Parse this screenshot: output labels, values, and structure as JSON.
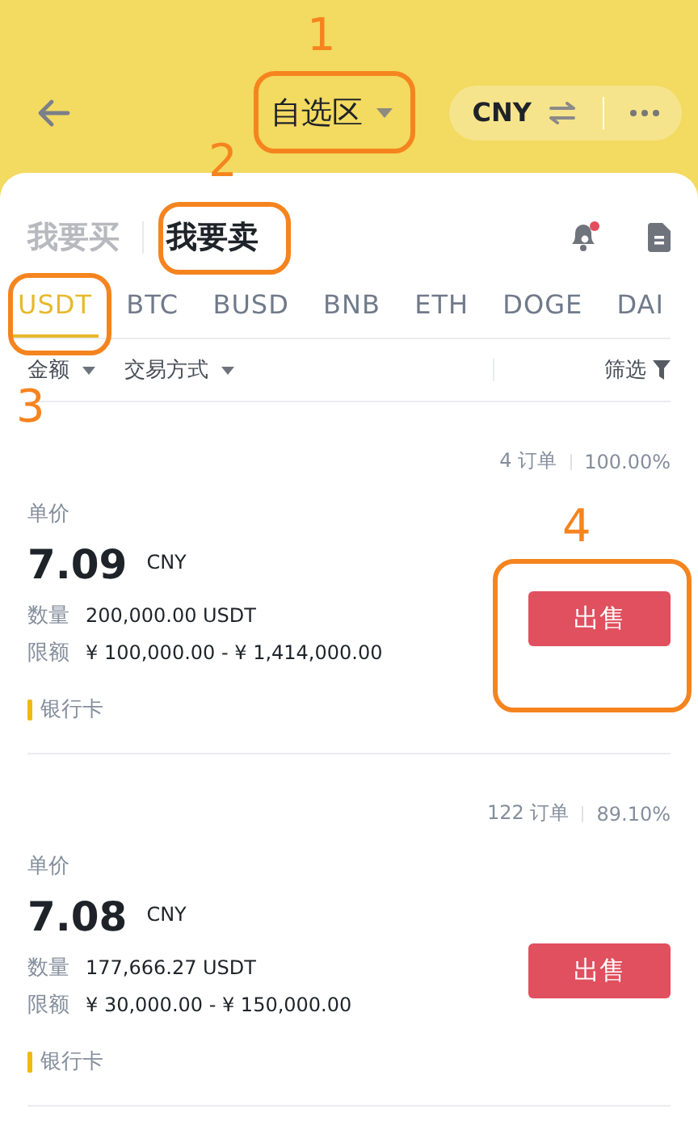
{
  "header": {
    "title": "自选区",
    "currency": "CNY"
  },
  "trade_tabs": [
    {
      "label": "我要买",
      "selected": false
    },
    {
      "label": "我要卖",
      "selected": true
    }
  ],
  "notification_unread": true,
  "coins": [
    {
      "label": "USDT",
      "selected": true
    },
    {
      "label": "BTC",
      "selected": false
    },
    {
      "label": "BUSD",
      "selected": false
    },
    {
      "label": "BNB",
      "selected": false
    },
    {
      "label": "ETH",
      "selected": false
    },
    {
      "label": "DOGE",
      "selected": false
    },
    {
      "label": "DAI",
      "selected": false
    }
  ],
  "filters": [
    {
      "label": "金额",
      "kind": "dropdown"
    },
    {
      "label": "交易方式",
      "kind": "dropdown"
    },
    {
      "label": "筛选",
      "kind": "filter"
    }
  ],
  "ads": [
    {
      "orders": "4 订单",
      "completion": "100.00%",
      "price_label": "单价",
      "price": "7.09",
      "currency": "CNY",
      "quantity_label": "数量",
      "quantity": "200,000.00 USDT",
      "limit_label": "限额",
      "limit": "¥ 100,000.00 - ¥ 1,414,000.00",
      "payment": "银行卡",
      "button": "出售"
    },
    {
      "orders": "122 订单",
      "completion": "89.10%",
      "price_label": "单价",
      "price": "7.08",
      "currency": "CNY",
      "quantity_label": "数量",
      "quantity": "177,666.27 USDT",
      "limit_label": "限额",
      "limit": "¥ 30,000.00 - ¥ 150,000.00",
      "payment": "银行卡",
      "button": "出售"
    }
  ],
  "annotations": [
    {
      "label": "1"
    },
    {
      "label": "2"
    },
    {
      "label": "3"
    },
    {
      "label": "4"
    }
  ]
}
